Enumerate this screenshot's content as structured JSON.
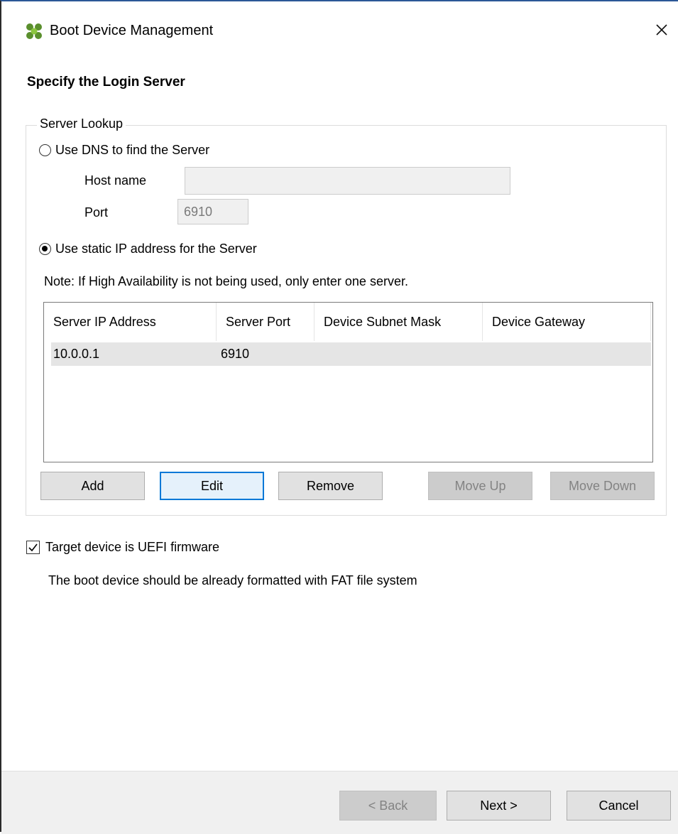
{
  "window": {
    "title": "Boot Device Management",
    "app_icon": "citrix-logo-icon",
    "close_icon": "close-icon"
  },
  "page": {
    "heading": "Specify the Login Server"
  },
  "server_lookup": {
    "group_label": "Server Lookup",
    "dns_option": {
      "label": "Use DNS to find the Server",
      "selected": false
    },
    "host_name": {
      "label": "Host name",
      "value": ""
    },
    "port": {
      "label": "Port",
      "value": "6910"
    },
    "static_option": {
      "label": "Use static IP address for the Server",
      "selected": true
    },
    "note": "Note: If High Availability is not being used, only enter one server.",
    "table": {
      "columns": [
        "Server IP Address",
        "Server Port",
        "Device Subnet Mask",
        "Device Gateway"
      ],
      "rows": [
        [
          "10.0.0.1",
          "6910",
          "",
          ""
        ]
      ]
    },
    "buttons": {
      "add": "Add",
      "edit": "Edit",
      "remove": "Remove",
      "move_up": "Move Up",
      "move_down": "Move Down"
    }
  },
  "uefi": {
    "label": "Target device is UEFI firmware",
    "checked": true,
    "note": "The boot device should be already formatted with FAT file system"
  },
  "footer": {
    "back": "< Back",
    "next": "Next >",
    "cancel": "Cancel"
  },
  "colors": {
    "accent": "#0078d7",
    "title_border": "#2b5797",
    "logo_green": "#5a8f2d",
    "logo_green_light": "#8cc63f"
  }
}
